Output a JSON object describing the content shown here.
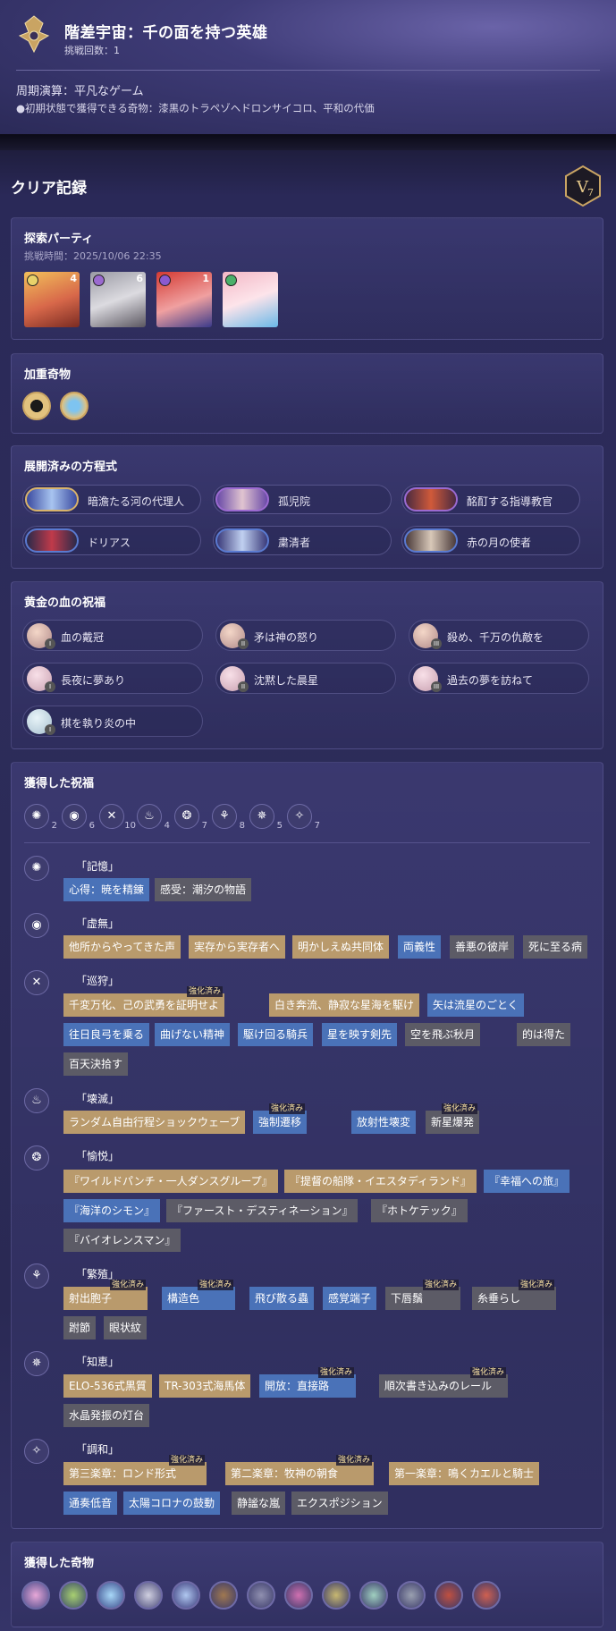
{
  "header": {
    "title": "階差宇宙：千の面を持つ英雄",
    "challenge_count": "挑戦回数：1",
    "cycle": "周期演算：平凡なゲーム",
    "initial_curios": "●初期状態で獲得できる奇物：漆黒のトラペゾヘドロンサイコロ、平和の代価"
  },
  "clear_record": {
    "title": "クリア記録",
    "badge_letter": "V",
    "badge_num": "7"
  },
  "party": {
    "title": "探索パーティ",
    "time": "挑戦時間：2025/10/06 22:35",
    "members": [
      {
        "level": "4"
      },
      {
        "level": "6"
      },
      {
        "level": "1"
      },
      {
        "level": ""
      }
    ]
  },
  "weighted": {
    "title": "加重奇物"
  },
  "equations": {
    "title": "展開済みの方程式",
    "items": [
      "暗澹たる河の代理人",
      "孤児院",
      "酩酊する指導教官",
      "ドリアス",
      "粛清者",
      "赤の月の使者"
    ]
  },
  "golden_blood": {
    "title": "黄金の血の祝福",
    "items": [
      {
        "label": "血の戴冠",
        "num": "I"
      },
      {
        "label": "矛は神の怒り",
        "num": "II"
      },
      {
        "label": "殺め、千万の仇敵を",
        "num": "III"
      },
      {
        "label": "長夜に夢あり",
        "num": "I"
      },
      {
        "label": "沈黙した晨星",
        "num": "II"
      },
      {
        "label": "過去の夢を訪ねて",
        "num": "III"
      },
      {
        "label": "棋を執り炎の中",
        "num": "I"
      }
    ]
  },
  "blessings": {
    "title": "獲得した祝福",
    "counts": [
      "2",
      "6",
      "10",
      "4",
      "7",
      "8",
      "5",
      "7"
    ],
    "strong_label": "強化済み",
    "paths": [
      {
        "name": "「記憶」",
        "glyph": "✺",
        "tags": [
          "心得：暁を精錬",
          "感受：潮汐の物語"
        ]
      },
      {
        "name": "「虚無」",
        "glyph": "◉",
        "tags": [
          "他所からやってきた声",
          "実存から実存者へ",
          "明かしえぬ共同体",
          "両義性",
          "善悪の彼岸",
          "死に至る病"
        ]
      },
      {
        "name": "「巡狩」",
        "glyph": "✕",
        "tags": [
          "千変万化、己の武勇を証明せよ",
          "白き奔流、静寂な星海を駆け",
          "矢は流星のごとく",
          "往日良弓を乗る",
          "曲げない精神",
          "駆け回る騎兵",
          "星を映す剣先",
          "空を飛ぶ秋月",
          "的は得た",
          "百天決拾す"
        ]
      },
      {
        "name": "「壊滅」",
        "glyph": "♨",
        "tags": [
          "ランダム自由行程ショックウェーブ",
          "強制遷移",
          "放射性壊変",
          "新星爆発"
        ]
      },
      {
        "name": "「愉悦」",
        "glyph": "❂",
        "tags": [
          "『ワイルドパンチ・一人ダンスグループ』",
          "『提督の船隊・イエスタディランド』",
          "『幸福への旅』",
          "『海洋のシモン』",
          "『ファースト・デスティネーション』",
          "『ホトケテック』",
          "『バイオレンスマン』"
        ]
      },
      {
        "name": "「繁殖」",
        "glyph": "⚘",
        "tags": [
          "射出胞子",
          "構造色",
          "飛び散る蟲",
          "感覚端子",
          "下唇鬚",
          "糸垂らし",
          "跗節",
          "眼状紋"
        ]
      },
      {
        "name": "「知恵」",
        "glyph": "✵",
        "tags": [
          "ELO-536式黒質",
          "TR-303式海馬体",
          "開放：直接路",
          "順次書き込みのレール",
          "水晶発振の灯台"
        ]
      },
      {
        "name": "「調和」",
        "glyph": "✧",
        "tags": [
          "第三楽章：ロンド形式",
          "第二楽章：牧神の朝食",
          "第一楽章：鳴くカエルと騎士",
          "通奏低音",
          "太陽コロナの鼓動",
          "静謐な嵐",
          "エクスポジション"
        ]
      }
    ]
  },
  "curios": {
    "title": "獲得した奇物"
  },
  "colors": {
    "gold": "#b99a6c",
    "blue": "#4a72b8",
    "gray": "#5c5b66",
    "accent": "#d9b36a"
  }
}
